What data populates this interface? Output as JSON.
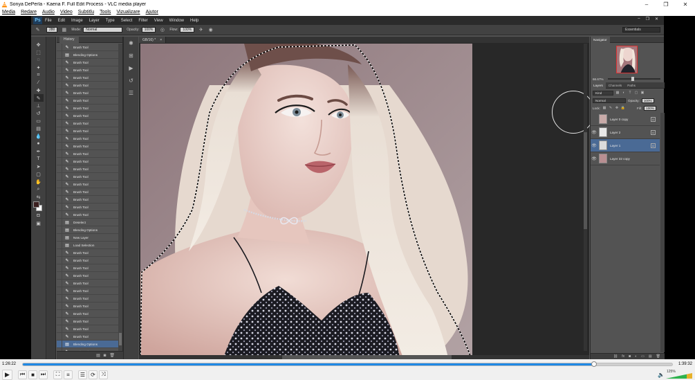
{
  "window": {
    "title": "Sonya DePerla - Kaena F. Full Edit Process - VLC media player",
    "minimize": "–",
    "maximize": "❐",
    "close": "✕"
  },
  "vlc_menu": [
    "Media",
    "Redare",
    "Audio",
    "Video",
    "Subtitlu",
    "Tools",
    "Vizualizare",
    "Ajutor"
  ],
  "photoshop": {
    "logo": "Ps",
    "menu": [
      "File",
      "Edit",
      "Image",
      "Layer",
      "Type",
      "Select",
      "Filter",
      "View",
      "Window",
      "Help"
    ],
    "window_controls": [
      "–",
      "❐",
      "✕"
    ],
    "options": {
      "mode_label": "Mode:",
      "mode_value": "Normal",
      "opacity_label": "Opacity:",
      "opacity_value": "100%",
      "flow_label": "Flow:",
      "flow_value": "100%",
      "brush_size": "280",
      "workspace": "Essentials"
    },
    "history": {
      "title": "History",
      "items": [
        "Brush Tool",
        "Blending Options",
        "Brush Tool",
        "Brush Tool",
        "Brush Tool",
        "Brush Tool",
        "Brush Tool",
        "Brush Tool",
        "Brush Tool",
        "Brush Tool",
        "Brush Tool",
        "Brush Tool",
        "Brush Tool",
        "Brush Tool",
        "Brush Tool",
        "Brush Tool",
        "Brush Tool",
        "Brush Tool",
        "Brush Tool",
        "Brush Tool",
        "Brush Tool",
        "Brush Tool",
        "Brush Tool",
        "Deselect",
        "Blending Options",
        "New Layer",
        "Load Selection",
        "Brush Tool",
        "Brush Tool",
        "Brush Tool",
        "Brush Tool",
        "Brush Tool",
        "Brush Tool",
        "Brush Tool",
        "Brush Tool",
        "Brush Tool",
        "Brush Tool",
        "Brush Tool",
        "Brush Tool",
        "Blending Options",
        "Brush Tool"
      ],
      "selected_index": 39
    },
    "document": {
      "tab": "GB/16) *"
    },
    "navigator": {
      "tab": "Navigator",
      "zoom": "66.67%"
    },
    "layers": {
      "tabs": [
        "Layers",
        "Channels",
        "Paths"
      ],
      "kind": "Kind",
      "blend_mode": "Normal",
      "opacity_label": "Opacity:",
      "opacity_value": "100%",
      "lock_label": "Lock:",
      "fill_label": "Fill:",
      "fill_value": "100%",
      "items": [
        {
          "name": "Layer 0 copy",
          "visible": false,
          "selected": false
        },
        {
          "name": "Layer 2",
          "visible": true,
          "selected": false
        },
        {
          "name": "Layer 1",
          "visible": true,
          "selected": true
        },
        {
          "name": "Layer 32 copy",
          "visible": true,
          "selected": false
        }
      ]
    }
  },
  "player": {
    "elapsed": "1:26:22",
    "total": "1:39:32",
    "progress": 0.88,
    "volume": "125%"
  }
}
